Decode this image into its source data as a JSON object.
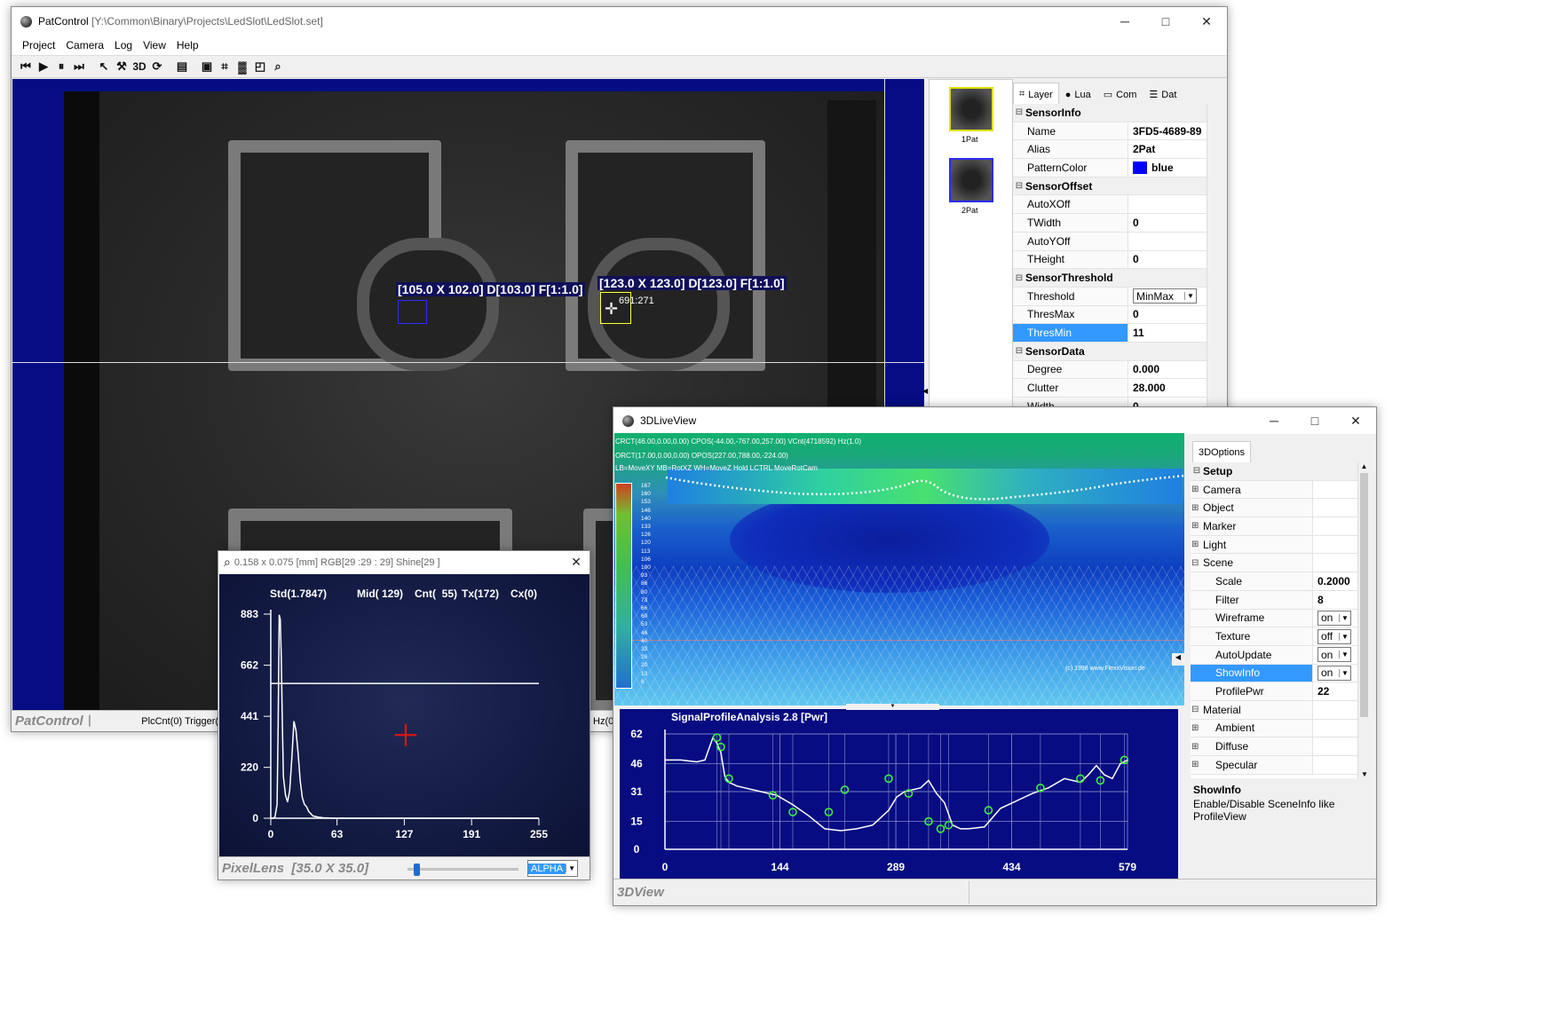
{
  "patcontrol": {
    "title": "PatControl",
    "path": "[Y:\\Common\\Binary\\Projects\\LedSlot\\LedSlot.set]",
    "menu": [
      "Project",
      "Camera",
      "Log",
      "View",
      "Help"
    ],
    "toolbar": {
      "threeD": "3D"
    },
    "overlay1": "[105.0 X 102.0] D[103.0] F[1:1.0]",
    "overlay2": "[123.0 X 123.0] D[123.0] F[1:1.0]",
    "cursor_readout": "691:271",
    "status_title": "PatControl",
    "status_text": "PlcCnt(0) Trigger(",
    "status_hz": "Hz(0",
    "thumbs": [
      "1Pat",
      "2Pat"
    ],
    "tabs": [
      "Layer",
      "Lua",
      "Com",
      "Dat"
    ],
    "props": [
      {
        "cat": "SensorInfo"
      },
      {
        "name": "Name",
        "value": "3FD5-4689-89"
      },
      {
        "name": "Alias",
        "value": "2Pat"
      },
      {
        "name": "PatternColor",
        "value": "blue",
        "color": "#0000ff"
      },
      {
        "cat": "SensorOffset"
      },
      {
        "name": "AutoXOff",
        "value": ""
      },
      {
        "name": "TWidth",
        "value": "0"
      },
      {
        "name": "AutoYOff",
        "value": ""
      },
      {
        "name": "THeight",
        "value": "0"
      },
      {
        "cat": "SensorThreshold"
      },
      {
        "name": "Threshold",
        "value": "MinMax",
        "dropdown": true
      },
      {
        "name": "ThresMax",
        "value": "0"
      },
      {
        "name": "ThresMin",
        "value": "11",
        "selected": true
      },
      {
        "cat": "SensorData"
      },
      {
        "name": "Degree",
        "value": "0.000"
      },
      {
        "name": "Clutter",
        "value": "28.000"
      },
      {
        "name": "Width",
        "value": "0"
      }
    ]
  },
  "pixellens": {
    "header": "0.158 x 0.075 [mm] RGB[29 :29 : 29] Shine[29 ]",
    "stats": {
      "std": "Std(1.7847)",
      "mid": "Mid( 129)",
      "cnt": "Cnt(  55)",
      "tx": "Tx(172)",
      "cx": "Cx(0)"
    },
    "status_title": "PixelLens  [35.0 X 35.0]",
    "alpha": "ALPHA",
    "slider": 0.05
  },
  "liveview": {
    "title": "3DLiveView",
    "info1": "CRCT(46.00,0.00,0.00) CPOS(-44.00,-767.00,257.00) VCnt(4718592) Hz(1.0)",
    "info2": "ORCT(17.00,0.00,0.00) OPOS(227.00,788.00,-224.00)",
    "info3": "LB=MoveXY MB=RotXZ WH=MoveZ  Hold LCTRL MoveRotCam",
    "copyright": "(c) 1998 www.FlexxVision.de",
    "scale_ticks": [
      "167",
      "160",
      "153",
      "146",
      "140",
      "133",
      "126",
      "120",
      "113",
      "106",
      "100",
      "93",
      "86",
      "80",
      "73",
      "66",
      "60",
      "53",
      "46",
      "40",
      "33",
      "26",
      "20",
      "13",
      "6"
    ],
    "status_title": "3DView",
    "tab": "3DOptions",
    "options": [
      {
        "cat": "Setup",
        "exp": "minus"
      },
      {
        "name": "Camera",
        "exp": "plus",
        "level": 0
      },
      {
        "name": "Object",
        "exp": "plus",
        "level": 0
      },
      {
        "name": "Marker",
        "exp": "plus",
        "level": 0
      },
      {
        "name": "Light",
        "exp": "plus",
        "level": 0
      },
      {
        "name": "Scene",
        "exp": "minus",
        "level": 0
      },
      {
        "name": "Scale",
        "value": "0.2000",
        "level": 1
      },
      {
        "name": "Filter",
        "value": "8",
        "level": 1
      },
      {
        "name": "Wireframe",
        "value": "on",
        "dropdown": true,
        "level": 1
      },
      {
        "name": "Texture",
        "value": "off",
        "dropdown": true,
        "level": 1
      },
      {
        "name": "AutoUpdate",
        "value": "on",
        "dropdown": true,
        "level": 1
      },
      {
        "name": "ShowInfo",
        "value": "on",
        "dropdown": true,
        "level": 1,
        "selected": true
      },
      {
        "name": "ProfilePwr",
        "value": "22",
        "level": 1
      },
      {
        "name": "Material",
        "exp": "minus",
        "level": 0
      },
      {
        "name": "Ambient",
        "exp": "plus",
        "level": 1
      },
      {
        "name": "Diffuse",
        "exp": "plus",
        "level": 1
      },
      {
        "name": "Specular",
        "exp": "plus",
        "level": 1
      }
    ],
    "help_title": "ShowInfo",
    "help_text": "Enable/Disable SceneInfo like ProfileView"
  },
  "chart_data": [
    {
      "type": "line",
      "title": "",
      "x_ticks": [
        "0",
        "63",
        "127",
        "191",
        "255"
      ],
      "y_ticks": [
        "0",
        "220",
        "441",
        "662",
        "883"
      ],
      "xlim": [
        0,
        255
      ],
      "ylim": [
        0,
        883
      ],
      "x": [
        0,
        2,
        4,
        6,
        7,
        8,
        9,
        10,
        11,
        12,
        14,
        16,
        18,
        20,
        22,
        24,
        26,
        28,
        30,
        32,
        34,
        36,
        38,
        40,
        45,
        50,
        60,
        80,
        120,
        160,
        200,
        255
      ],
      "y": [
        0,
        0,
        5,
        60,
        400,
        880,
        860,
        700,
        420,
        180,
        100,
        70,
        120,
        260,
        420,
        380,
        280,
        160,
        90,
        60,
        50,
        30,
        20,
        10,
        5,
        2,
        0,
        0,
        0,
        0,
        0,
        0
      ],
      "threshold": 583
    },
    {
      "type": "line",
      "title": "SignalProfileAnalysis 2.8 [Pwr]",
      "x_ticks": [
        "0",
        "144",
        "289",
        "434",
        "579"
      ],
      "y_ticks": [
        "0",
        "15",
        "31",
        "46",
        "62"
      ],
      "xlim": [
        0,
        579
      ],
      "ylim": [
        0,
        62
      ],
      "x": [
        0,
        20,
        40,
        50,
        60,
        65,
        70,
        75,
        80,
        90,
        100,
        120,
        140,
        160,
        180,
        200,
        220,
        240,
        260,
        280,
        290,
        300,
        320,
        330,
        340,
        350,
        360,
        370,
        380,
        400,
        420,
        440,
        460,
        480,
        500,
        520,
        530,
        540,
        550,
        560,
        570,
        579
      ],
      "y": [
        48,
        48,
        47,
        48,
        60,
        57,
        52,
        39,
        36,
        34,
        33,
        31,
        29,
        24,
        18,
        11,
        10,
        11,
        13,
        21,
        28,
        31,
        33,
        37,
        30,
        25,
        13,
        11,
        11,
        12,
        22,
        26,
        30,
        33,
        38,
        36,
        40,
        45,
        40,
        38,
        46,
        48
      ],
      "markers_x": [
        65,
        70,
        80,
        135,
        160,
        205,
        225,
        280,
        305,
        330,
        345,
        355,
        405,
        470,
        520,
        545,
        575
      ],
      "markers_y": [
        60,
        55,
        38,
        29,
        20,
        20,
        32,
        38,
        30,
        15,
        11,
        13,
        21,
        33,
        38,
        37,
        48
      ]
    }
  ]
}
